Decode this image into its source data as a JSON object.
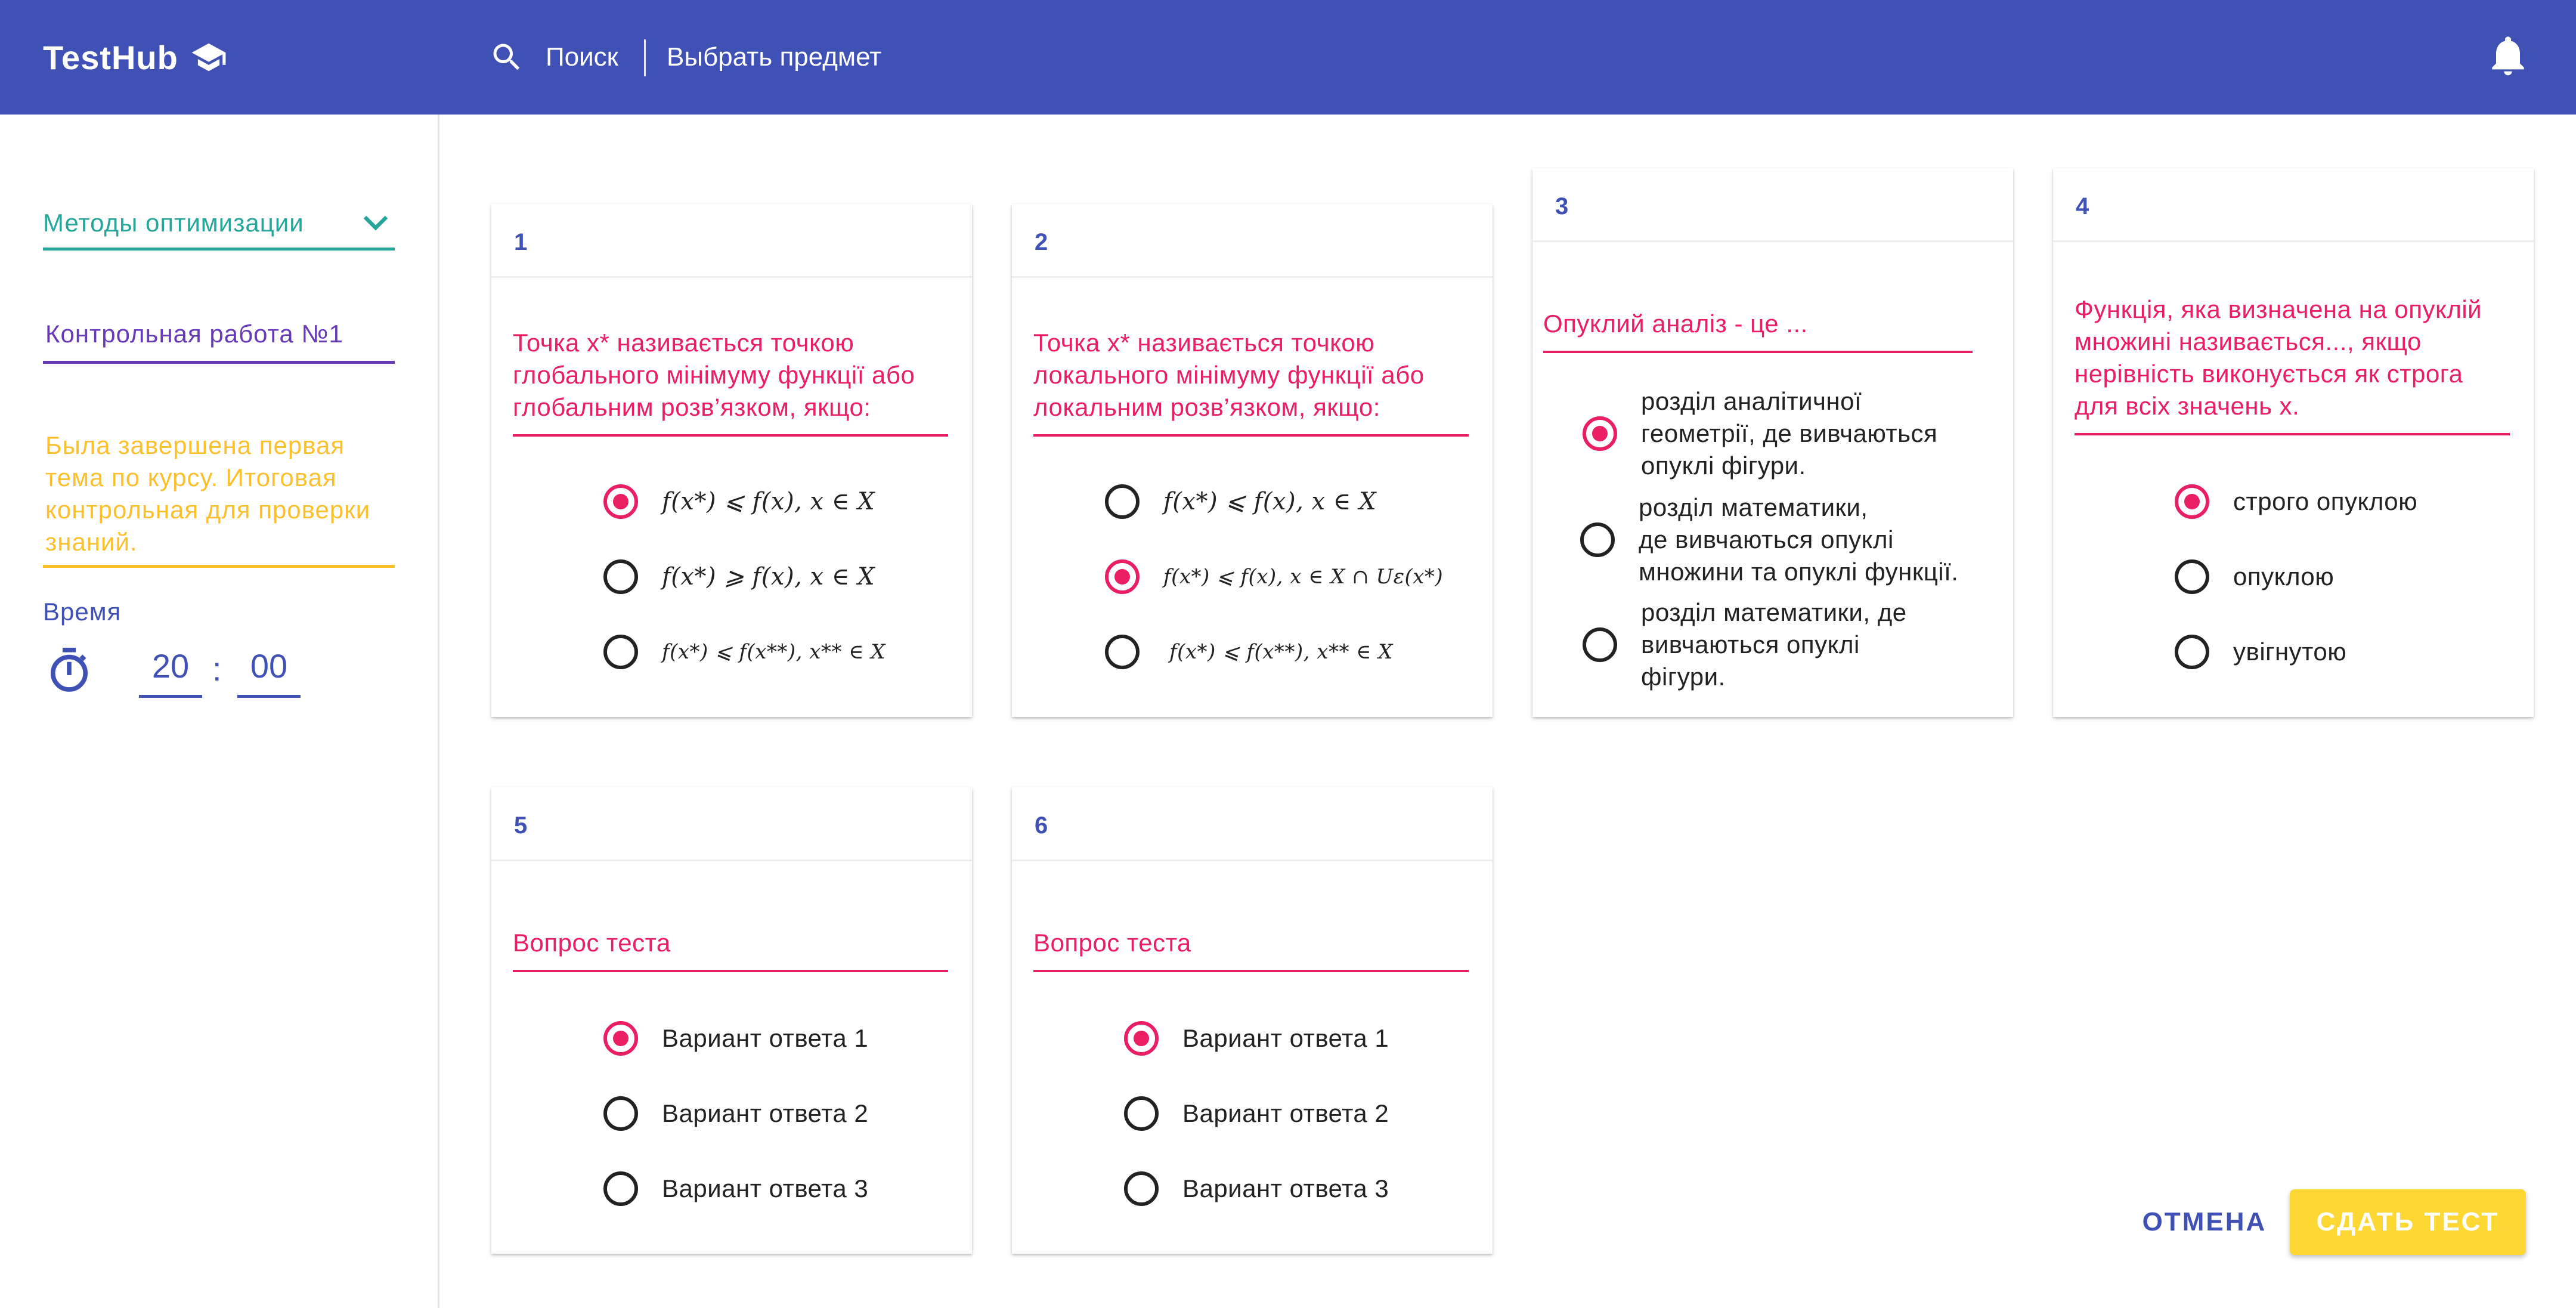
{
  "appbar": {
    "brand": "TestHub",
    "search_label": "Поиск",
    "subject_label": "Выбрать предмет"
  },
  "sidebar": {
    "subject": "Методы оптимизации",
    "test_name": "Контрольная работа №1",
    "description": "Была завершена первая тема по курсу. Итоговая контрольная для проверки знаний.",
    "time_label": "Время",
    "time_minutes": "20",
    "time_separator": ":",
    "time_seconds": "00"
  },
  "questions": [
    {
      "number": "1",
      "question": "Точка x* називається точкою глобального мінімуму функції або глобальним розв’язком, якщо:",
      "options": [
        "f(x*) ⩽ f(x), x ∈ X",
        "f(x*) ⩾ f(x), x ∈ X",
        "f(x*) ⩽ f(x**), x** ∈ X"
      ],
      "selected_index": 0
    },
    {
      "number": "2",
      "question": "Точка x* називається точкою локального мінімуму функції або локальним розв’язком, якщо:",
      "options": [
        "f(x*) ⩽ f(x), x ∈ X",
        "f(x*) ⩽ f(x), x ∈ X ∩ Uε(x*)",
        "f(x*) ⩽ f(x**), x** ∈ X"
      ],
      "selected_index": 1
    },
    {
      "number": "3",
      "question": "Опуклий аналіз - це ...",
      "options": [
        [
          "розділ аналітичної",
          "геометрії, де вивчаються",
          "опуклі фігури."
        ],
        [
          "розділ математики,",
          "де вивчаються опуклі",
          "множини та опуклі функції."
        ],
        [
          "розділ математики, де",
          "вивчаються опуклі",
          "фігури."
        ]
      ],
      "selected_index": 0
    },
    {
      "number": "4",
      "question": "Функція, яка визначена на опуклій множині називається..., якщо нерівність виконується як строга для всіх значень x.",
      "options": [
        "строго опуклою",
        "опуклою",
        "увігнутою"
      ],
      "selected_index": 0
    },
    {
      "number": "5",
      "question": "Вопрос теста",
      "options": [
        "Вариант ответа 1",
        "Вариант ответа 2",
        "Вариант ответа 3"
      ],
      "selected_index": 0
    },
    {
      "number": "6",
      "question": "Вопрос теста",
      "options": [
        "Вариант ответа 1",
        "Вариант ответа 2",
        "Вариант ответа 3"
      ],
      "selected_index": 0
    }
  ],
  "actions": {
    "cancel": "ОТМЕНА",
    "submit": "СДАТЬ ТЕСТ"
  },
  "colors": {
    "primary": "#3f51b5",
    "accent": "#e91e63",
    "teal": "#26a69a",
    "purple": "#673ab7",
    "amber": "#fbc02d",
    "submit": "#fdd835"
  },
  "icons": [
    "graduation-cap-icon",
    "search-icon",
    "bell-icon",
    "chevron-down-icon",
    "timer-icon",
    "radio-icon"
  ]
}
